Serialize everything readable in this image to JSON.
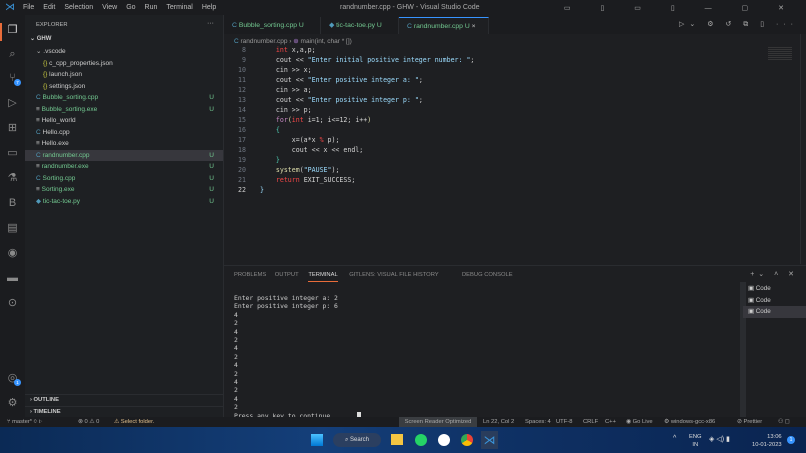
{
  "title": "randnumber.cpp - GHW - Visual Studio Code",
  "menu": [
    "File",
    "Edit",
    "Selection",
    "View",
    "Go",
    "Run",
    "Terminal",
    "Help"
  ],
  "explorer": {
    "header": "EXPLORER",
    "more": "···",
    "root": "GHW",
    "items": [
      {
        "name": ".vscode",
        "icon": "chevron-down",
        "indent": 1,
        "status": ""
      },
      {
        "name": "c_cpp_properties.json",
        "icon": "{}",
        "indent": 2,
        "status": ""
      },
      {
        "name": "launch.json",
        "icon": "{}",
        "indent": 2,
        "status": ""
      },
      {
        "name": "settings.json",
        "icon": "{}",
        "indent": 2,
        "status": ""
      },
      {
        "name": "Bubble_sorting.cpp",
        "icon": "C",
        "indent": 1,
        "status": "U"
      },
      {
        "name": "Bubble_sorting.exe",
        "icon": "≡",
        "indent": 1,
        "status": "U"
      },
      {
        "name": "Hello_world",
        "icon": "≡",
        "indent": 1,
        "status": ""
      },
      {
        "name": "Hello.cpp",
        "icon": "C",
        "indent": 1,
        "status": ""
      },
      {
        "name": "Hello.exe",
        "icon": "≡",
        "indent": 1,
        "status": ""
      },
      {
        "name": "randnumber.cpp",
        "icon": "C",
        "indent": 1,
        "status": "U"
      },
      {
        "name": "randnumber.exe",
        "icon": "≡",
        "indent": 1,
        "status": "U"
      },
      {
        "name": "Sorting.cpp",
        "icon": "C",
        "indent": 1,
        "status": "U"
      },
      {
        "name": "Sorting.exe",
        "icon": "≡",
        "indent": 1,
        "status": "U"
      },
      {
        "name": "tic-tac-toe.py",
        "icon": "◆",
        "indent": 1,
        "status": "U"
      }
    ],
    "outline": "OUTLINE",
    "timeline": "TIMELINE"
  },
  "scm_badge": "7",
  "accounts_badge": "1",
  "tabs": [
    {
      "label": "Bubble_sorting.cpp",
      "status": "U"
    },
    {
      "label": "tic-tac-toe.py",
      "status": "U"
    },
    {
      "label": "randnumber.cpp",
      "status": "U",
      "close": "×"
    }
  ],
  "breadcrumb": {
    "file": "randnumber.cpp",
    "symbol": "main(int, char * [])"
  },
  "code": [
    {
      "n": "8",
      "tokens": [
        [
          "ty",
          "int"
        ],
        [
          "v",
          " x,a,p;"
        ]
      ]
    },
    {
      "n": "9",
      "tokens": [
        [
          "v",
          "cout << "
        ],
        [
          "s",
          "\"Enter initial positive integer number: \""
        ],
        [
          "v",
          ";"
        ]
      ]
    },
    {
      "n": "10",
      "tokens": [
        [
          "v",
          "cin >> x;"
        ]
      ]
    },
    {
      "n": "11",
      "tokens": [
        [
          "v",
          "cout << "
        ],
        [
          "s",
          "\"Enter positive integer a: \""
        ],
        [
          "v",
          ";"
        ]
      ]
    },
    {
      "n": "12",
      "tokens": [
        [
          "v",
          "cin >> a;"
        ]
      ]
    },
    {
      "n": "13",
      "tokens": [
        [
          "v",
          "cout << "
        ],
        [
          "s",
          "\"Enter positive integer p: \""
        ],
        [
          "v",
          ";"
        ]
      ]
    },
    {
      "n": "14",
      "tokens": [
        [
          "v",
          "cin >> p;"
        ]
      ]
    },
    {
      "n": "15",
      "tokens": [
        [
          "k",
          "for"
        ],
        [
          "f",
          "("
        ],
        [
          "ty",
          "int"
        ],
        [
          "v",
          " i=1; i<=12; i++"
        ],
        [
          "f",
          ")"
        ]
      ]
    },
    {
      "n": "16",
      "tokens": [
        [
          "p",
          "{"
        ]
      ]
    },
    {
      "n": "17",
      "tokens": [
        [
          "v",
          "    x=(a*x "
        ],
        [
          "ty",
          "%"
        ],
        [
          "v",
          " p);"
        ]
      ]
    },
    {
      "n": "18",
      "tokens": [
        [
          "v",
          "    cout << x << endl;"
        ]
      ]
    },
    {
      "n": "19",
      "tokens": [
        [
          "p",
          "}"
        ]
      ]
    },
    {
      "n": "20",
      "tokens": [
        [
          "f",
          "system"
        ],
        [
          "v",
          "("
        ],
        [
          "s",
          "\"PAUSE\""
        ],
        [
          "v",
          ");"
        ]
      ]
    },
    {
      "n": "21",
      "tokens": [
        [
          "ty",
          "return"
        ],
        [
          "v",
          " EXIT_SUCCESS;"
        ]
      ]
    },
    {
      "n": "22",
      "tokens": [
        [
          "s",
          "}"
        ]
      ]
    }
  ],
  "panel": {
    "tabs": [
      "PROBLEMS",
      "OUTPUT",
      "TERMINAL",
      "GITLENS: VISUAL FILE HISTORY",
      "DEBUG CONSOLE"
    ],
    "active": "TERMINAL",
    "terminal": [
      "Enter positive integer a: 2",
      "Enter positive integer p: 6",
      "4",
      "2",
      "4",
      "2",
      "4",
      "2",
      "4",
      "2",
      "4",
      "2",
      "4",
      "2",
      "Press any key to continue . . . "
    ],
    "sessions": [
      "Code",
      "Code",
      "Code"
    ]
  },
  "status": {
    "branch": "master*",
    "problems": "⊗ 0 ⚠ 0",
    "select_folder": "⚠ Select folder.",
    "screen_reader": "Screen Reader Optimized",
    "position": "Ln 22, Col 2",
    "spaces": "Spaces: 4",
    "encoding": "UTF-8",
    "eol": "CRLF",
    "language": "C++",
    "golive": "Go Live",
    "config": "windows-gcc-x86",
    "prettier": "Prettier"
  },
  "taskbar": {
    "search": "Search",
    "lang": "ENG",
    "region": "IN",
    "time": "13:06",
    "date": "10-01-2023",
    "notif": "1"
  }
}
